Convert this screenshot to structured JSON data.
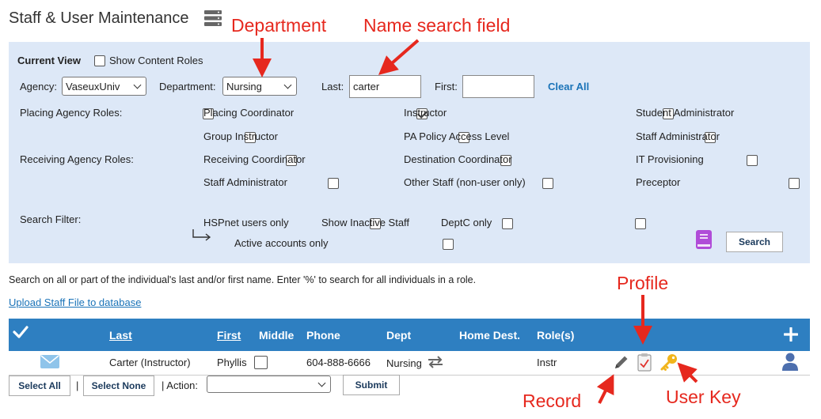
{
  "title": "Staff & User Maintenance",
  "icons": [
    "server-icon",
    "book-icon",
    "mail-icon",
    "transfer-arrows-icon",
    "pencil-icon",
    "checklist-icon",
    "key-icon",
    "person-icon",
    "plus-icon",
    "check-icon"
  ],
  "colors": {
    "header_blue": "#2e7fc1",
    "panel_bg": "#dde8f7",
    "annotation_red": "#e6281e",
    "link_blue": "#1a73b8"
  },
  "filters": {
    "current_view_label": "Current View",
    "show_content_roles_label": "Show Content Roles",
    "show_content_roles_checked": false,
    "agency_label": "Agency:",
    "agency_value": "VaseuxUniv",
    "department_label": "Department:",
    "department_value": "Nursing",
    "last_label": "Last:",
    "last_value": "carter",
    "first_label": "First:",
    "first_value": "",
    "clear_all": "Clear All"
  },
  "roles": {
    "placing_label": "Placing Agency Roles:",
    "receiving_label": "Receiving Agency Roles:",
    "items": [
      {
        "label": "Placing Coordinator",
        "checked": false
      },
      {
        "label": "Instructor",
        "checked": true
      },
      {
        "label": "Student Administrator",
        "checked": false
      },
      {
        "label": "Group Instructor",
        "checked": false
      },
      {
        "label": "PA Policy Access Level",
        "checked": false
      },
      {
        "label": "Staff Administrator",
        "checked": false
      },
      {
        "label": "Receiving Coordinator",
        "checked": false
      },
      {
        "label": "Destination Coordinator",
        "checked": false
      },
      {
        "label": "IT Provisioning",
        "checked": false
      },
      {
        "label": "Staff Administrator",
        "checked": false
      },
      {
        "label": "Other Staff (non-user only)",
        "checked": false
      },
      {
        "label": "Preceptor",
        "checked": false
      }
    ]
  },
  "search_filter": {
    "label": "Search Filter:",
    "hspnet_only": "HSPnet users only",
    "show_inactive": "Show Inactive Staff",
    "deptc_only": "DeptC only",
    "active_only": "Active accounts only",
    "search_button": "Search"
  },
  "help_text": "Search on all or part of the individual's last and/or first name. Enter '%' to search for all individuals in a role.",
  "upload_link": "Upload Staff File to database",
  "table": {
    "headers": {
      "last": "Last",
      "first": "First",
      "middle": "Middle",
      "phone": "Phone",
      "dept": "Dept",
      "home_dest": "Home Dest.",
      "roles": "Role(s)"
    },
    "rows": [
      {
        "last": "Carter (Instructor)",
        "first": "Phyllis",
        "middle": "",
        "phone": "604-888-6666",
        "dept": "Nursing",
        "home_dest": "",
        "roles": "Instr"
      }
    ]
  },
  "footer": {
    "select_all": "Select All",
    "sep1": "|",
    "select_none": "Select None",
    "action_label": "| Action:",
    "action_value": "",
    "submit": "Submit"
  },
  "annotations": {
    "department": "Department",
    "name_search": "Name search field",
    "profile": "Profile",
    "record": "Record",
    "user_key": "User Key"
  }
}
